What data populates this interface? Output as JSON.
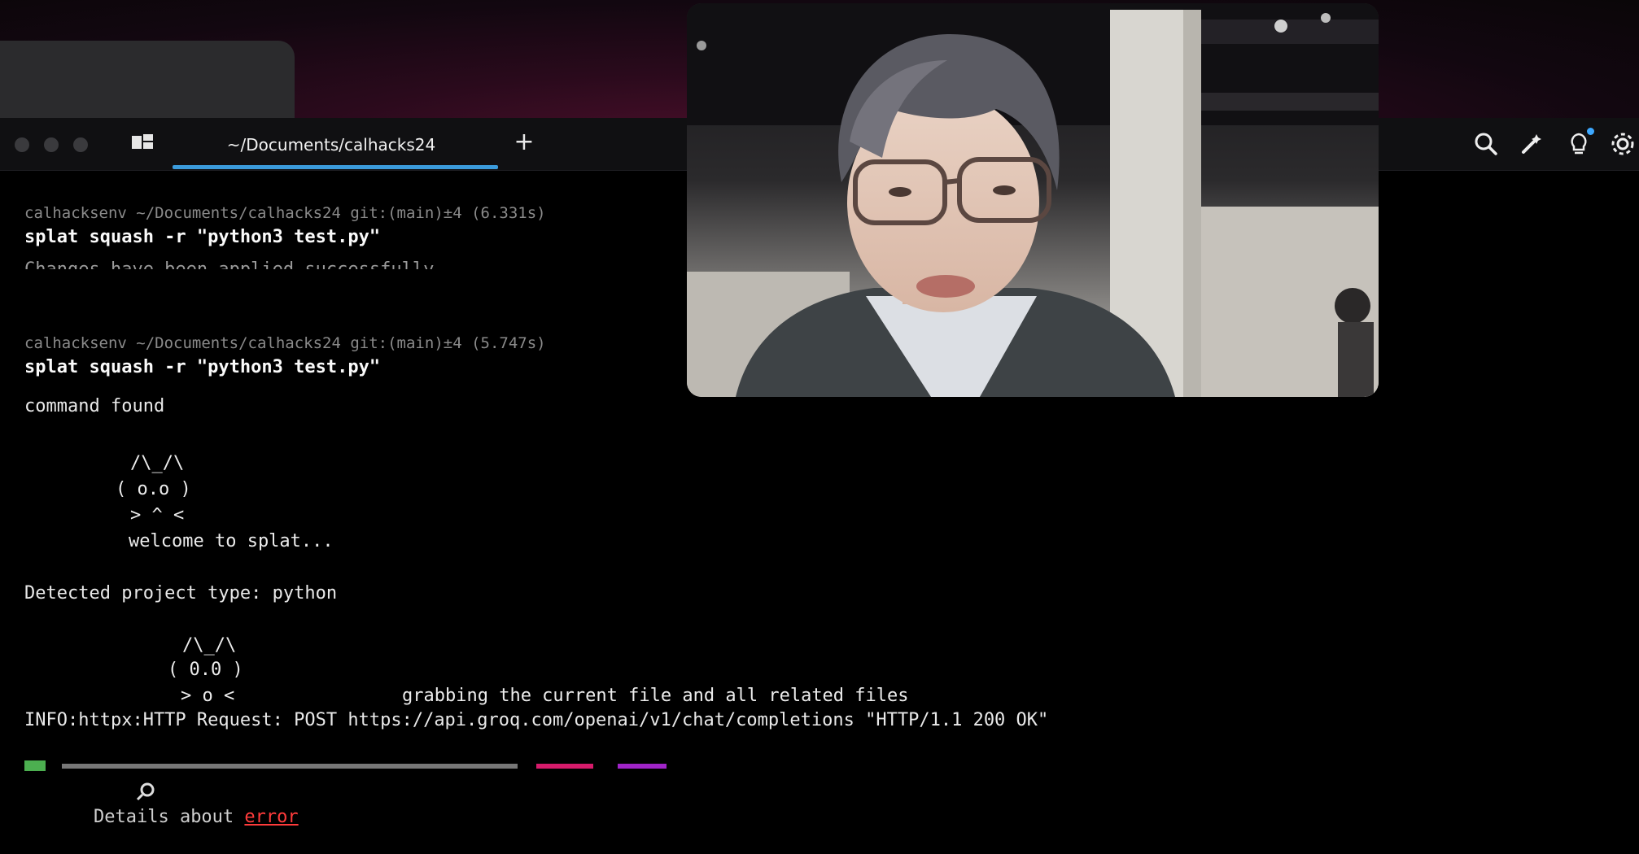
{
  "terminal": {
    "tab_title": "~/Documents/calhacks24",
    "new_tab": "+",
    "lines": {
      "prompt1": "calhacksenv ~/Documents/calhacks24 git:(main)±4 (6.331s)",
      "cmd1": "splat squash -r \"python3 test.py\"",
      "partial": "Changes have been applied successfully.",
      "prompt2": "calhacksenv ~/Documents/calhacks24 git:(main)±4 (5.747s)",
      "cmd2": "splat squash -r \"python3 test.py\"",
      "found": "command found",
      "art1_a": "/\\_/\\",
      "art1_b": "( o.o )",
      "art1_c": "> ^ <",
      "welcome": "welcome to splat...",
      "detected": "Detected project type: python",
      "art2_a": "/\\_/\\",
      "art2_b": "( 0.0 )",
      "art2_c": "> o <",
      "grabbing": "grabbing the current file and all related files",
      "info": "INFO:httpx:HTTP Request: POST https://api.groq.com/openai/v1/chat/completions \"HTTP/1.1 200 OK\"",
      "details_prefix": "Details about ",
      "details_error": "error"
    }
  },
  "icons": {
    "search": "search-icon",
    "wand": "magic-wand-icon",
    "bulb": "lightbulb-icon",
    "settings": "gear-icon"
  },
  "colors": {
    "accent": "#3b9bdb",
    "error": "#ff3b3b",
    "terminal_bg": "#000000"
  }
}
